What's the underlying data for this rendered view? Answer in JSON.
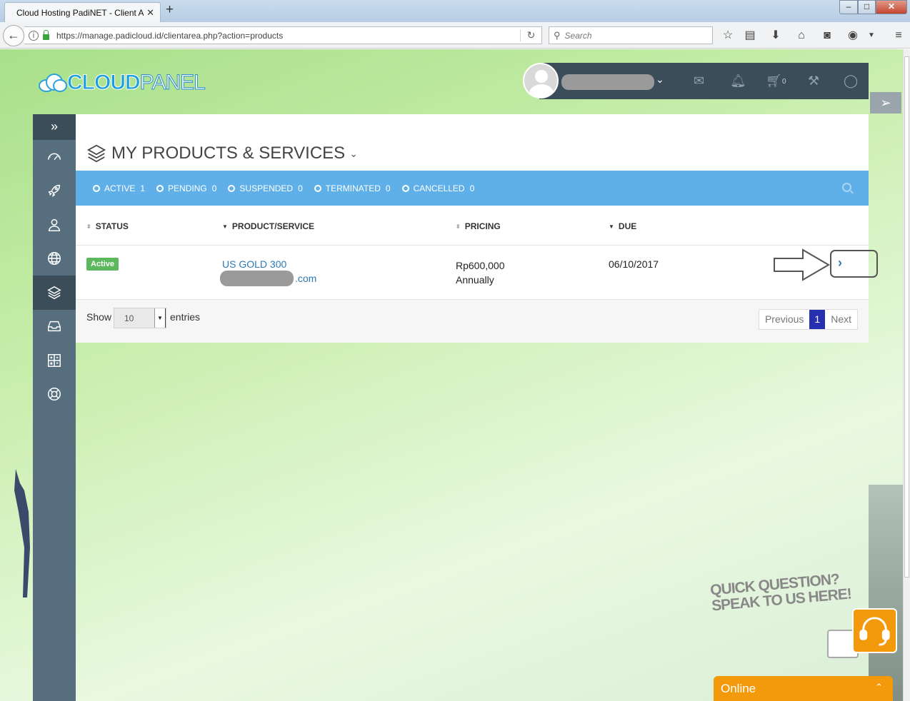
{
  "browser": {
    "tab_title": "Cloud Hosting PadiNET - Client A",
    "tab_close": "✕",
    "new_tab": "+",
    "url": "https://manage.padicloud.id/clientarea.php?action=products",
    "search_placeholder": "Search"
  },
  "brand": {
    "logo_cloud": "CLOUD",
    "logo_panel": "PANEL"
  },
  "header": {
    "cart_count": "0"
  },
  "sidebar": {
    "toggle": "»",
    "items": [
      {
        "icon": "dashboard-icon"
      },
      {
        "icon": "rocket-icon"
      },
      {
        "icon": "user-icon"
      },
      {
        "icon": "globe-icon"
      },
      {
        "icon": "layers-icon",
        "active": true
      },
      {
        "icon": "inbox-icon"
      },
      {
        "icon": "calculator-icon"
      },
      {
        "icon": "support-icon"
      }
    ]
  },
  "main": {
    "title": "MY PRODUCTS & SERVICES",
    "filters": [
      {
        "label": "ACTIVE",
        "count": "1"
      },
      {
        "label": "PENDING",
        "count": "0"
      },
      {
        "label": "SUSPENDED",
        "count": "0"
      },
      {
        "label": "TERMINATED",
        "count": "0"
      },
      {
        "label": "CANCELLED",
        "count": "0"
      }
    ],
    "columns": {
      "status": "STATUS",
      "product": "PRODUCT/SERVICE",
      "pricing": "PRICING",
      "due": "DUE"
    },
    "rows": [
      {
        "status": "Active",
        "product": "US GOLD 300",
        "domain_suffix": ".com",
        "price": "Rp600,000",
        "cycle": "Annually",
        "due": "06/10/2017"
      }
    ],
    "footer": {
      "show": "Show",
      "entries_value": "10",
      "entries": "entries",
      "previous": "Previous",
      "page": "1",
      "next": "Next"
    }
  },
  "chat": {
    "promo_line1": "QUICK QUESTION?",
    "promo_line2": "SPEAK TO US HERE!",
    "status": "Online"
  },
  "colors": {
    "accent_blue": "#5fb0e9",
    "sidebar": "#566e7d",
    "sidebar_dark": "#3c4d5a",
    "active_badge": "#5cb85c",
    "chat_orange": "#f29a0c",
    "pager_current": "#2531b0"
  }
}
